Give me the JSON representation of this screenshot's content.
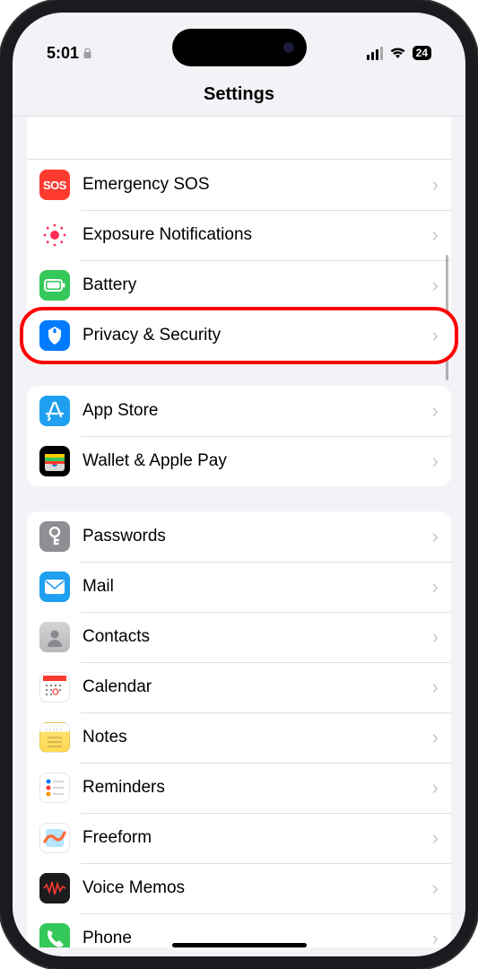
{
  "status": {
    "time": "5:01",
    "battery": "24"
  },
  "header": {
    "title": "Settings"
  },
  "section1": {
    "sos": "Emergency SOS",
    "exposure": "Exposure Notifications",
    "battery": "Battery",
    "privacy": "Privacy & Security"
  },
  "section2": {
    "appstore": "App Store",
    "wallet": "Wallet & Apple Pay"
  },
  "section3": {
    "passwords": "Passwords",
    "mail": "Mail",
    "contacts": "Contacts",
    "calendar": "Calendar",
    "notes": "Notes",
    "reminders": "Reminders",
    "freeform": "Freeform",
    "voicememos": "Voice Memos",
    "phone": "Phone"
  },
  "icons": {
    "sos": "SOS"
  }
}
